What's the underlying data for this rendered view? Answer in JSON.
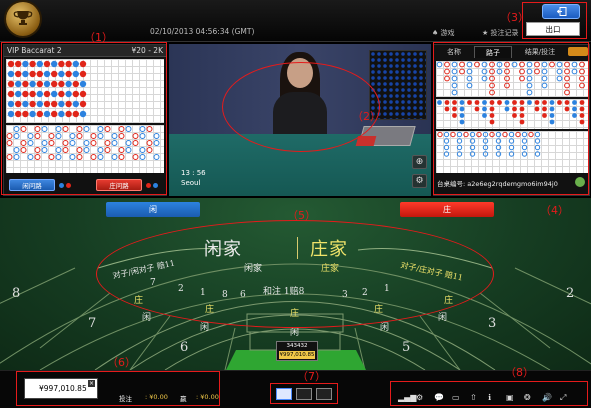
{
  "header": {
    "datetime": "02/10/2013 04:56:34 (GMT)",
    "nav_help": "♠ 游戏",
    "nav_history": "★ 投注记录",
    "exit_tooltip": "出口"
  },
  "annotations": {
    "m1": "（1）",
    "m2": "（2）",
    "m3": "（3）",
    "m4": "（4）",
    "m5": "（5）",
    "m6": "（6）",
    "m7": "（7）",
    "m8": "（8）"
  },
  "left_panel": {
    "table_name": "VIP Baccarat 2",
    "limits": "¥20 - 2K",
    "player_ask_label": "闲问路",
    "banker_ask_label": "庄问路"
  },
  "video": {
    "time": "13 : 56",
    "location": "Seoul",
    "zoom_icon": "⊕",
    "settings_icon": "⚙"
  },
  "right_panel": {
    "tabs": [
      "名称",
      "路子",
      "结果/投注"
    ],
    "shoe_code": "台桌编号: a2e6eg2rqdemgmo6im94j0"
  },
  "table": {
    "player_button": "闲",
    "banker_button": "庄",
    "title_player": "闲家",
    "title_banker": "庄家",
    "sub_player": "闲家",
    "sub_banker": "庄家",
    "player_pair_arc": "对子/闲对子 赔11",
    "banker_pair_arc": "对子/庄对子 赔11",
    "tie_label": "和注 1赔8",
    "seat_numbers": [
      "8",
      "7",
      "6",
      "5",
      "3",
      "2",
      "1",
      "8",
      "7",
      "6",
      "5",
      "3",
      "2",
      "1"
    ],
    "row_banker": "庄",
    "row_player": "闲",
    "chip_code": "343432",
    "chip_amount": "¥997,010.85"
  },
  "bottom": {
    "balance": "¥997,010.85",
    "total_bet_label": "投注",
    "total_bet_value": ": ¥0.00",
    "win_label": "赢",
    "win_value": ": ¥0.00",
    "tool_icons": [
      "▂▄▆",
      "⚙",
      "💬",
      "▭",
      "⇧",
      "ℹ",
      "▣",
      "❂",
      "🔊",
      "⤢"
    ]
  },
  "colors": {
    "player_blue": "#2c82df",
    "banker_red": "#e0261a",
    "felt_green": "#1b4a29",
    "gold": "#f0e46a",
    "annotation_red": "#e51b1b"
  }
}
